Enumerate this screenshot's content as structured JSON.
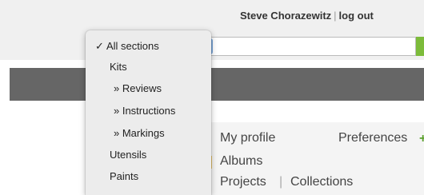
{
  "header": {
    "user_name": "Steve Chorazewitz",
    "separator": "|",
    "logout_label": "log out"
  },
  "search": {
    "value": "",
    "placeholder": ""
  },
  "section_dropdown": {
    "selected_check": "✓",
    "options": [
      {
        "label": "All sections"
      },
      {
        "label": "Kits"
      },
      {
        "label": "» Reviews"
      },
      {
        "label": "» Instructions"
      },
      {
        "label": "» Markings"
      },
      {
        "label": "Utensils"
      },
      {
        "label": "Paints"
      }
    ]
  },
  "user_menu": {
    "my_profile": "My profile",
    "preferences": "Preferences",
    "plus": "+",
    "albums": "Albums",
    "projects": "Projects",
    "separator": "|",
    "collections": "Collections"
  },
  "colors": {
    "accent_green": "#7cbb3a",
    "nav_bar": "#666666"
  }
}
